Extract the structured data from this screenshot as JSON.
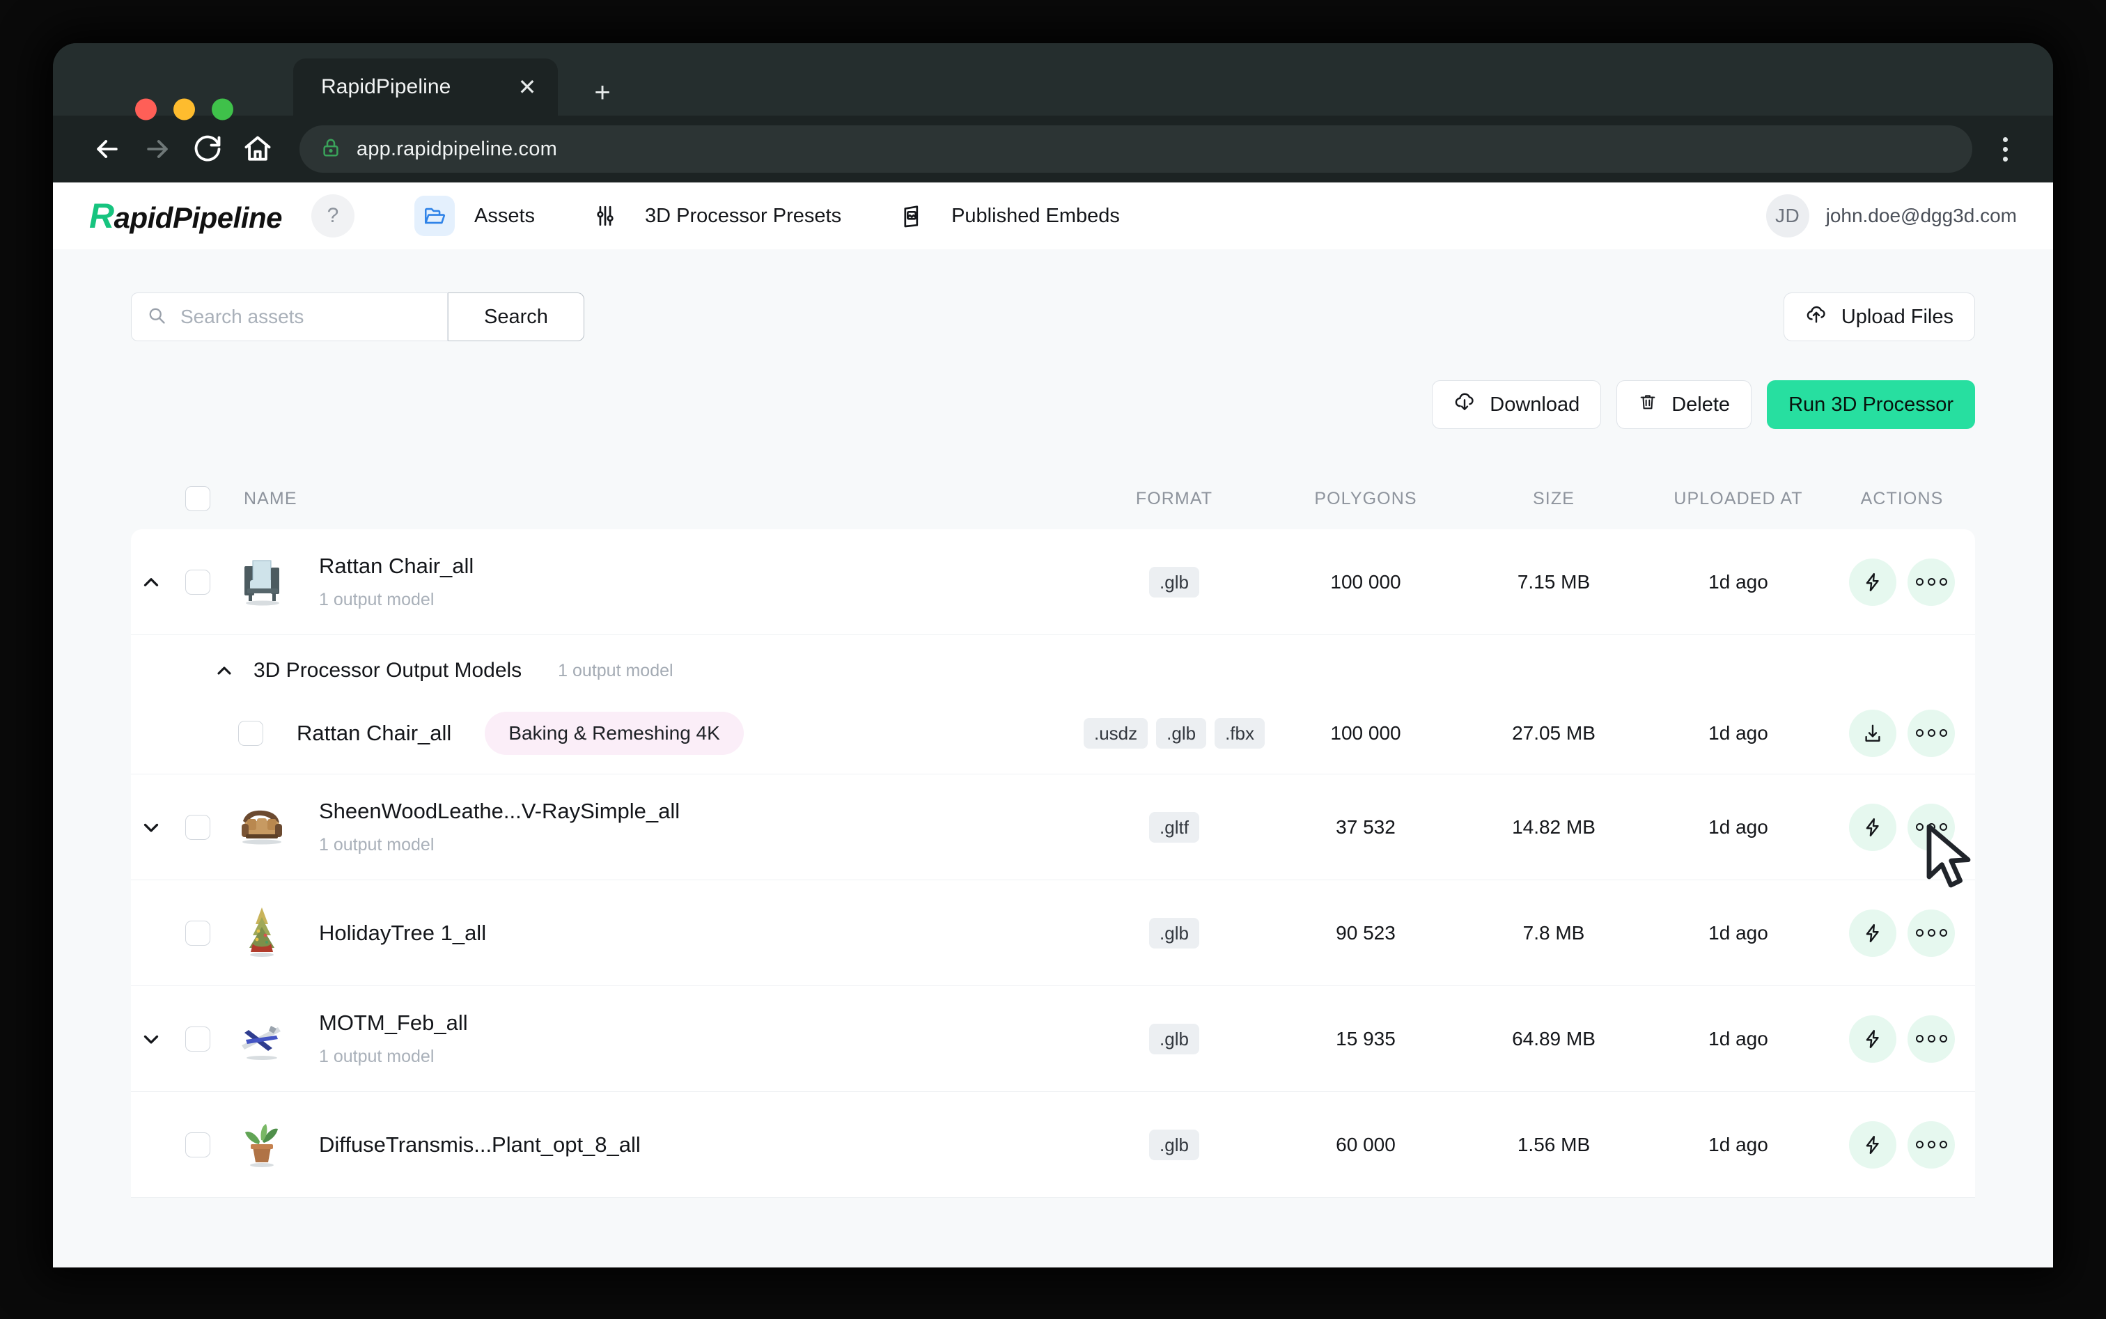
{
  "browser": {
    "tab_title": "RapidPipeline",
    "close_label": "✕",
    "newtab_label": "+",
    "url": "app.rapidpipeline.com"
  },
  "appbar": {
    "logo_mark": "R",
    "logo_rest": "apidPipeline",
    "help_label": "?",
    "nav": [
      {
        "label": "Assets",
        "icon": "folder-open-icon",
        "active": true
      },
      {
        "label": "3D Processor Presets",
        "icon": "sliders-icon",
        "active": false
      },
      {
        "label": "Published Embeds",
        "icon": "image-card-icon",
        "active": false
      }
    ],
    "user": {
      "initials": "JD",
      "email": "john.doe@dgg3d.com"
    }
  },
  "toolbar": {
    "search_placeholder": "Search assets",
    "search_value": "",
    "search_button": "Search",
    "upload_label": "Upload Files",
    "download_label": "Download",
    "delete_label": "Delete",
    "run_label": "Run 3D Processor",
    "accent_color": "#27dfa0"
  },
  "table": {
    "columns": [
      "NAME",
      "FORMAT",
      "POLYGONS",
      "SIZE",
      "UPLOADED AT",
      "ACTIONS"
    ],
    "group": {
      "title": "3D Processor Output Models",
      "count": "1 output model"
    },
    "rows": [
      {
        "name": "Rattan Chair_all",
        "sub": "1 output model",
        "formats": [
          ".glb"
        ],
        "polygons": "100 000",
        "size": "7.15 MB",
        "uploaded": "1d ago",
        "expanded": true,
        "thumb": "rattan-chair"
      },
      {
        "name": "Rattan Chair_all",
        "pill": "Baking & Remeshing 4K",
        "formats": [
          ".usdz",
          ".glb",
          ".fbx"
        ],
        "polygons": "100 000",
        "size": "27.05 MB",
        "uploaded": "1d ago",
        "child": true
      },
      {
        "name": "SheenWoodLeathe...V-RaySimple_all",
        "sub": "1 output model",
        "formats": [
          ".gltf"
        ],
        "polygons": "37 532",
        "size": "14.82 MB",
        "uploaded": "1d ago",
        "expanded": false,
        "thumb": "sofa"
      },
      {
        "name": "HolidayTree 1_all",
        "sub": "",
        "formats": [
          ".glb"
        ],
        "polygons": "90 523",
        "size": "7.8 MB",
        "uploaded": "1d ago",
        "thumb": "tree"
      },
      {
        "name": "MOTM_Feb_all",
        "sub": "1 output model",
        "formats": [
          ".glb"
        ],
        "polygons": "15 935",
        "size": "64.89 MB",
        "uploaded": "1d ago",
        "expanded": false,
        "thumb": "plane"
      },
      {
        "name": "DiffuseTransmis...Plant_opt_8_all",
        "sub": "",
        "formats": [
          ".glb"
        ],
        "polygons": "60 000",
        "size": "1.56 MB",
        "uploaded": "1d ago",
        "thumb": "plant"
      }
    ]
  }
}
